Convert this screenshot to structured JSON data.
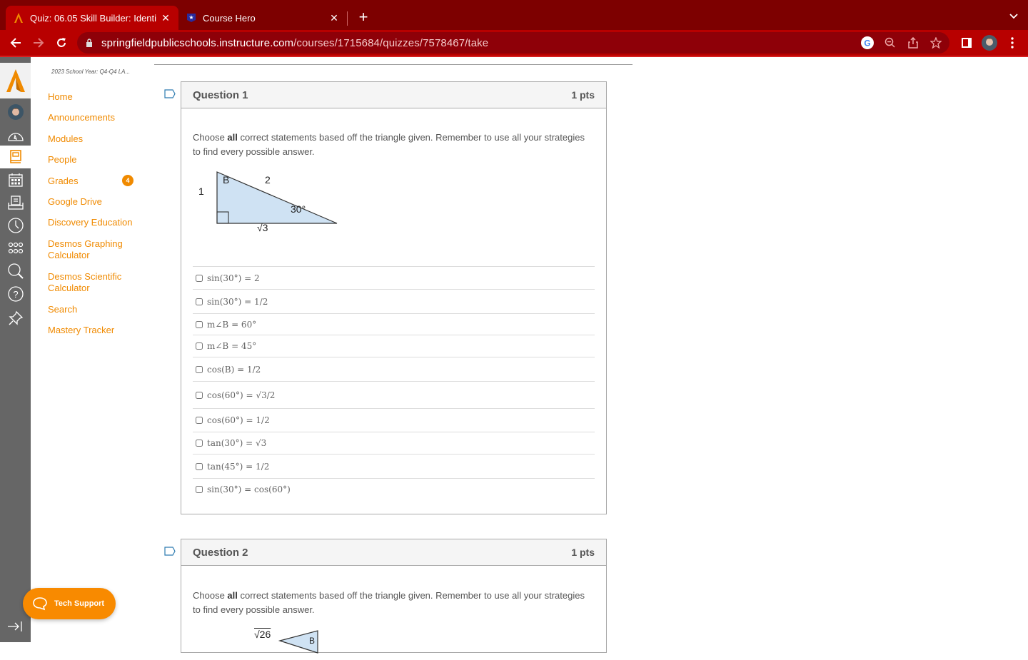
{
  "browser": {
    "tabs": [
      {
        "title": "Quiz: 06.05 Skill Builder: Identi",
        "favicon": "canvas-logo-icon",
        "active": true
      },
      {
        "title": "Course Hero",
        "favicon": "course-hero-icon",
        "active": false
      }
    ],
    "url_host": "springfieldpublicschools.instructure.com",
    "url_path": "/courses/1715684/quizzes/7578467/take",
    "accent": "#b80000"
  },
  "global_nav": {
    "items": [
      "account",
      "dashboard",
      "courses",
      "calendar",
      "inbox",
      "history",
      "commons",
      "search",
      "help",
      "pin"
    ],
    "active": "courses"
  },
  "course_nav": {
    "breadcrumb": "2023 School Year: Q4-Q4 LA...",
    "items": [
      {
        "label": "Home"
      },
      {
        "label": "Announcements"
      },
      {
        "label": "Modules"
      },
      {
        "label": "People"
      },
      {
        "label": "Grades",
        "badge": "4"
      },
      {
        "label": "Google Drive"
      },
      {
        "label": "Discovery Education"
      },
      {
        "label": "Desmos Graphing Calculator"
      },
      {
        "label": "Desmos Scientific Calculator"
      },
      {
        "label": "Search"
      },
      {
        "label": "Mastery Tracker"
      }
    ],
    "link_color": "#f08a00"
  },
  "questions": [
    {
      "title": "Question 1",
      "points": "1 pts",
      "prompt_pre": "Choose ",
      "prompt_bold": "all",
      "prompt_post": " correct statements based off the triangle given. Remember to use all your strategies to find every possible answer.",
      "figure": {
        "angle_label": "B",
        "hypotenuse": "2",
        "short_leg": "1",
        "long_leg": "√3",
        "angle": "30°"
      },
      "answers": [
        "sin(30°) = 2",
        "sin(30°) = 1/2",
        "m∠B = 60°",
        "m∠B = 45°",
        "cos(B) = 1/2",
        "cos(60°) = √3/2",
        "cos(60°) = 1/2",
        "tan(30°) = √3",
        "tan(45°) = 1/2",
        "sin(30°) = cos(60°)"
      ]
    },
    {
      "title": "Question 2",
      "points": "1 pts",
      "prompt_pre": "Choose ",
      "prompt_bold": "all",
      "prompt_post": " correct statements based off the triangle given. Remember to use all your strategies to find every possible answer.",
      "figure": {
        "hypotenuse": "√26",
        "angle_label": "B"
      }
    }
  ],
  "tech_support": {
    "label": "Tech Support"
  }
}
